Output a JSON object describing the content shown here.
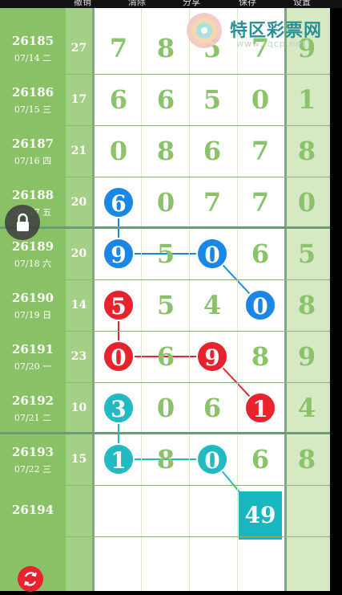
{
  "toolbar": {
    "undo": "撤销",
    "clear": "清除",
    "share": "分享",
    "save": "保存",
    "settings": "设置"
  },
  "watermark": {
    "name": "特区彩票网",
    "url": "www.tqcp.net"
  },
  "rows": [
    {
      "issue": "26185",
      "date": "07/14 二",
      "sum": "27",
      "digits": [
        "7",
        "8",
        "5",
        "7"
      ],
      "last": "9"
    },
    {
      "issue": "26186",
      "date": "07/15 三",
      "sum": "17",
      "digits": [
        "6",
        "6",
        "5",
        "0"
      ],
      "last": "1"
    },
    {
      "issue": "26187",
      "date": "07/16 四",
      "sum": "21",
      "digits": [
        "0",
        "8",
        "6",
        "7"
      ],
      "last": "8"
    },
    {
      "issue": "26188",
      "date": "07/17 五",
      "sum": "20",
      "digits": [
        "6",
        "0",
        "7",
        "7"
      ],
      "last": "0"
    },
    {
      "issue": "26189",
      "date": "07/18 六",
      "sum": "20",
      "digits": [
        "9",
        "5",
        "0",
        "6"
      ],
      "last": "5"
    },
    {
      "issue": "26190",
      "date": "07/19 日",
      "sum": "14",
      "digits": [
        "5",
        "5",
        "4",
        "0"
      ],
      "last": "8"
    },
    {
      "issue": "26191",
      "date": "07/20 一",
      "sum": "23",
      "digits": [
        "0",
        "6",
        "9",
        "8"
      ],
      "last": "9"
    },
    {
      "issue": "26192",
      "date": "07/21 二",
      "sum": "10",
      "digits": [
        "3",
        "0",
        "6",
        "1"
      ],
      "last": "4"
    },
    {
      "issue": "26193",
      "date": "07/22 三",
      "sum": "15",
      "digits": [
        "1",
        "8",
        "0",
        "6"
      ],
      "last": "8"
    },
    {
      "issue": "26194",
      "date": "",
      "sum": "",
      "digits": [
        "",
        "",
        "",
        ""
      ],
      "last": ""
    }
  ],
  "marks": [
    {
      "row": 3,
      "col": 0,
      "color": "blue"
    },
    {
      "row": 4,
      "col": 0,
      "color": "blue"
    },
    {
      "row": 4,
      "col": 2,
      "color": "blue"
    },
    {
      "row": 5,
      "col": 3,
      "color": "blue"
    },
    {
      "row": 5,
      "col": 0,
      "color": "red"
    },
    {
      "row": 6,
      "col": 0,
      "color": "red"
    },
    {
      "row": 6,
      "col": 2,
      "color": "red"
    },
    {
      "row": 7,
      "col": 3,
      "color": "red"
    },
    {
      "row": 7,
      "col": 0,
      "color": "teal"
    },
    {
      "row": 8,
      "col": 0,
      "color": "teal"
    },
    {
      "row": 8,
      "col": 2,
      "color": "teal"
    }
  ],
  "special": {
    "value": "49"
  },
  "icons": {
    "lock": "lock-icon",
    "refresh": "refresh-icon"
  },
  "colors": {
    "blue": "#1a86e6",
    "red": "#e8232d",
    "teal": "#21b9c2",
    "digit": "#8bc36a"
  }
}
